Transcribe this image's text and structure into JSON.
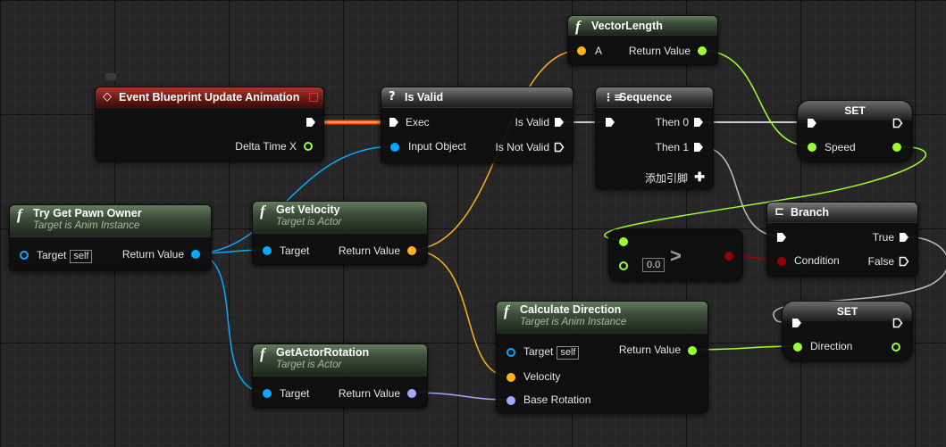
{
  "colors": {
    "exec": "#ffffff",
    "float": "#9cff30",
    "object": "#0aa8ff",
    "struct": "#ffb21a",
    "rotator": "#a0a8ff",
    "bool": "#950000",
    "event_header": "#a8352d",
    "function_header": "#3b4d38",
    "pure_header": "#5a5a5a"
  },
  "nodes": {
    "event_update": {
      "title": "Event Blueprint Update Animation",
      "icon": "event-diamond-icon",
      "delta_time": "Delta Time X"
    },
    "try_get_pawn": {
      "title": "Try Get Pawn Owner",
      "subtitle": "Target is Anim Instance",
      "target": "Target",
      "self": "self",
      "return": "Return Value"
    },
    "get_velocity": {
      "title": "Get Velocity",
      "subtitle": "Target is Actor",
      "target": "Target",
      "return": "Return Value"
    },
    "get_actor_rotation": {
      "title": "GetActorRotation",
      "subtitle": "Target is Actor",
      "target": "Target",
      "return": "Return Value"
    },
    "is_valid": {
      "title": "Is Valid",
      "icon": "question-icon",
      "exec": "Exec",
      "input": "Input Object",
      "is_valid": "Is Valid",
      "is_not_valid": "Is Not Valid"
    },
    "vector_length": {
      "title": "VectorLength",
      "a": "A",
      "return": "Return Value"
    },
    "sequence": {
      "title": "Sequence",
      "then0": "Then 0",
      "then1": "Then 1",
      "add_pin": "添加引脚"
    },
    "set_speed": {
      "title": "SET",
      "var": "Speed"
    },
    "greater": {
      "op": ">",
      "b_value": "0.0"
    },
    "branch": {
      "title": "Branch",
      "true": "True",
      "condition": "Condition",
      "false": "False"
    },
    "calc_direction": {
      "title": "Calculate Direction",
      "subtitle": "Target is Anim Instance",
      "target": "Target",
      "self": "self",
      "velocity": "Velocity",
      "base_rotation": "Base Rotation",
      "return": "Return Value"
    },
    "set_direction": {
      "title": "SET",
      "var": "Direction"
    }
  }
}
